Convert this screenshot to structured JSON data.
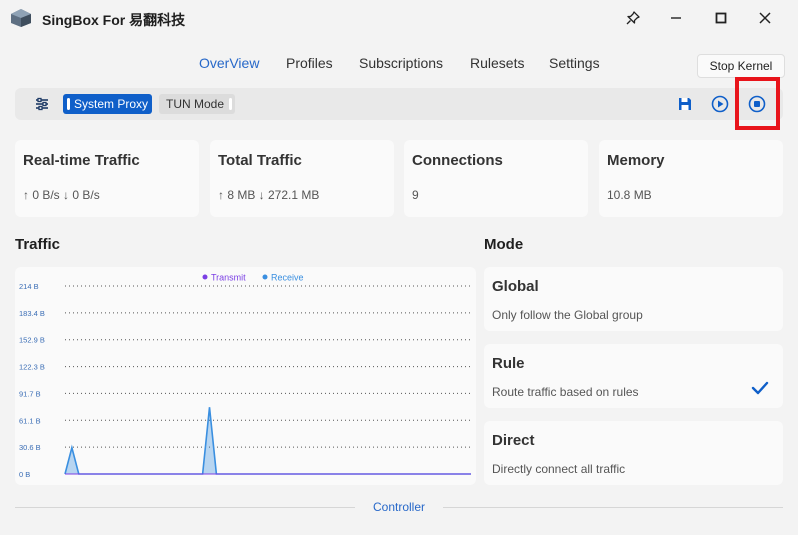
{
  "window": {
    "title": "SingBox For 易翻科技",
    "pin_icon": "pin-icon",
    "minimize_icon": "minimize-icon",
    "maximize_icon": "maximize-icon",
    "close_icon": "close-icon"
  },
  "nav": {
    "items": [
      {
        "label": "OverView",
        "active": true
      },
      {
        "label": "Profiles",
        "active": false
      },
      {
        "label": "Subscriptions",
        "active": false
      },
      {
        "label": "Rulesets",
        "active": false
      },
      {
        "label": "Settings",
        "active": false
      }
    ]
  },
  "toolbar": {
    "settings_icon": "sliders-icon",
    "system_proxy_label": "System Proxy",
    "tun_mode_label": "TUN Mode",
    "save_icon": "save-icon",
    "restart_icon": "play-circle-icon",
    "stop_icon": "stop-circle-icon",
    "tooltip": "Stop Kernel"
  },
  "stats": [
    {
      "title": "Real-time Traffic",
      "value": "↑ 0 B/s ↓ 0 B/s"
    },
    {
      "title": "Total Traffic",
      "value": "↑ 8 MB ↓ 272.1 MB"
    },
    {
      "title": "Connections",
      "value": "9"
    },
    {
      "title": "Memory",
      "value": "10.8 MB"
    }
  ],
  "traffic": {
    "title": "Traffic"
  },
  "chart_data": {
    "type": "area",
    "series": [
      {
        "name": "Transmit",
        "color": "#7b3fe4"
      },
      {
        "name": "Receive",
        "color": "#3a8fe0"
      }
    ],
    "y_ticks": [
      "214 B",
      "183.4 B",
      "152.9 B",
      "122.3 B",
      "91.7 B",
      "61.1 B",
      "30.6 B",
      "0 B"
    ],
    "ylim": [
      0,
      214
    ],
    "grid": true,
    "legend": "top",
    "points": 60,
    "receive_values": [
      0,
      30,
      0,
      0,
      0,
      0,
      0,
      0,
      0,
      0,
      0,
      0,
      0,
      0,
      0,
      0,
      0,
      0,
      0,
      0,
      0,
      0,
      0,
      0,
      0,
      0,
      0,
      0,
      0,
      0,
      0,
      0,
      0,
      0,
      0,
      0,
      0,
      0,
      0,
      0,
      0,
      0,
      0,
      0,
      0,
      0,
      0,
      0,
      0,
      0,
      0,
      0,
      0,
      0,
      0,
      0,
      0,
      0,
      0,
      0
    ],
    "spike2_values": [
      0,
      0,
      0,
      0,
      0,
      0,
      0,
      0,
      0,
      0,
      0,
      0,
      0,
      0,
      0,
      0,
      0,
      0,
      0,
      0,
      0,
      0,
      0,
      0,
      0,
      0,
      0,
      0,
      0,
      0,
      0,
      0,
      0,
      0,
      0,
      0,
      0,
      0,
      0,
      0,
      0,
      0,
      0,
      0,
      0,
      0,
      0,
      0,
      0,
      0,
      0,
      0,
      0,
      0,
      0,
      0,
      0,
      0,
      0,
      0
    ],
    "peaks": [
      {
        "index": 1,
        "value": 30
      },
      {
        "index": 21,
        "value": 76
      }
    ]
  },
  "mode": {
    "title": "Mode",
    "options": [
      {
        "title": "Global",
        "desc": "Only follow the Global group",
        "selected": false
      },
      {
        "title": "Rule",
        "desc": "Route traffic based on rules",
        "selected": true
      },
      {
        "title": "Direct",
        "desc": "Directly connect all traffic",
        "selected": false
      }
    ],
    "check_icon": "checkmark-icon"
  },
  "footer": {
    "controller_label": "Controller"
  },
  "colors": {
    "accent": "#0f5fc9",
    "highlight": "#e8141b"
  }
}
